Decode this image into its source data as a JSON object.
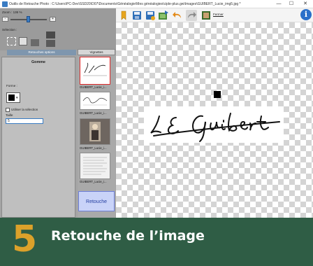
{
  "window": {
    "title": "Outils de Retouche Photo : C:\\Users\\PC-Dev\\SSD20\\D07\\Documents\\Généalogie\\Mes généalogies\\ciple-plus.gw\\Images\\GUIBERT_Lucie_img5.jpg *",
    "min": "—",
    "max": "☐",
    "close": "✕"
  },
  "toolbar": {
    "fermer_label": "Fermer"
  },
  "left": {
    "zoom_label": "Zoom : 136 %",
    "minus": "-",
    "plus": "+",
    "selection_label": "Sélection :",
    "tab_label": "Retouches options",
    "panel_title": "Gomme",
    "forme_label": "Forme :",
    "utiliser_label": "Utiliser la sélection",
    "taille_label": "Taille",
    "taille_value": "5"
  },
  "vignettes": {
    "header": "Vignettes",
    "items": [
      {
        "label": "GUIBERT_Lucie_i..."
      },
      {
        "label": "GUIBERT_Lucie_i..."
      },
      {
        "label": "GUIBERT_Lucie_i..."
      },
      {
        "label": "GUIBERT_Lucie_i..."
      }
    ],
    "retouche_label": "Retouche"
  },
  "canvas": {
    "signature_text": "L E Guibert"
  },
  "banner": {
    "number": "5",
    "title": "Retouche de l’image"
  },
  "colors": {
    "banner_bg": "#2f5d45",
    "banner_number": "#dca12a",
    "accent": "#3a7cc3"
  }
}
